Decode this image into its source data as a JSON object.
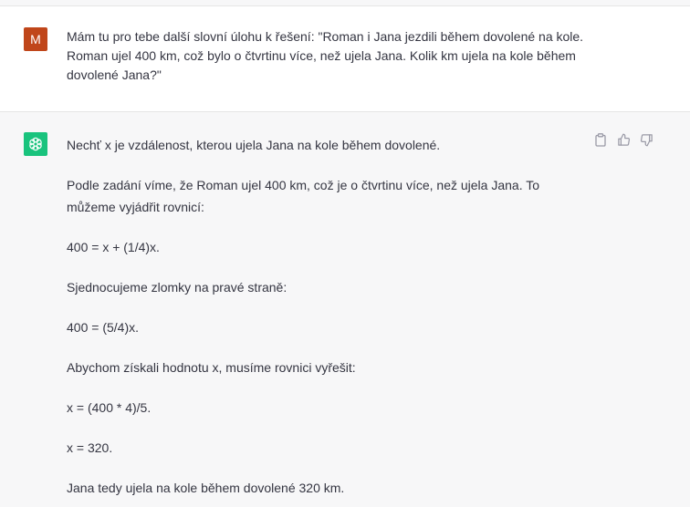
{
  "user_message": {
    "avatar_letter": "M",
    "lines": [
      "Mám tu pro tebe další slovní úlohu k řešení: \"Roman i Jana jezdili během dovolené na kole.",
      "Roman ujel 400 km, což bylo o čtvrtinu více, než ujela Jana. Kolik km ujela na kole během",
      "dovolené Jana?\""
    ]
  },
  "assistant_message": {
    "avatar_icon": "openai-logo-icon",
    "paragraphs": [
      "Nechť x je vzdálenost, kterou ujela Jana na kole během dovolené.",
      "Podle zadání víme, že Roman ujel 400 km, což je o čtvrtinu více, než ujela Jana. To můžeme vyjádřit rovnicí:",
      "400 = x + (1/4)x.",
      "Sjednocujeme zlomky na pravé straně:",
      "400 = (5/4)x.",
      "Abychom získali hodnotu x, musíme rovnici vyřešit:",
      "x = (400 * 4)/5.",
      "x = 320.",
      "Jana tedy ujela na kole během dovolené 320 km."
    ],
    "actions": [
      "copy-icon",
      "thumbs-up-icon",
      "thumbs-down-icon"
    ]
  },
  "colors": {
    "user_avatar": "#c0461a",
    "bot_avatar": "#19c37d",
    "assistant_bg": "#f7f7f8"
  }
}
